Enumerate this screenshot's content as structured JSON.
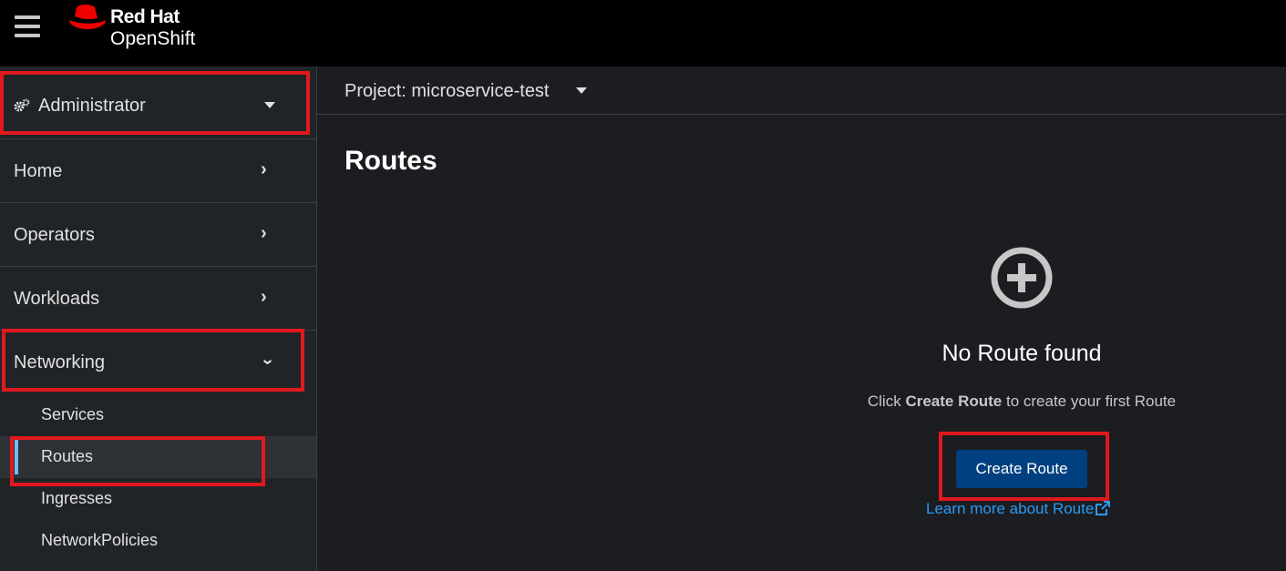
{
  "masthead": {
    "brand_top": "Red Hat",
    "brand_bottom": "OpenShift",
    "menu_icon": "hamburger-icon",
    "logo_icon": "red-hat-fedora-icon"
  },
  "sidebar": {
    "perspective": {
      "label": "Administrator",
      "icon": "cogs-icon"
    },
    "sections": [
      {
        "label": "Home",
        "expanded": false
      },
      {
        "label": "Operators",
        "expanded": false
      },
      {
        "label": "Workloads",
        "expanded": false
      },
      {
        "label": "Networking",
        "expanded": true
      }
    ],
    "networking_items": [
      {
        "label": "Services",
        "active": false
      },
      {
        "label": "Routes",
        "active": true
      },
      {
        "label": "Ingresses",
        "active": false
      },
      {
        "label": "NetworkPolicies",
        "active": false
      }
    ]
  },
  "project_bar": {
    "label": "Project: microservice-test"
  },
  "page": {
    "title": "Routes"
  },
  "empty_state": {
    "icon": "plus-circle-icon",
    "title": "No Route found",
    "body_prefix": "Click ",
    "body_strong": "Create Route",
    "body_suffix": " to create your first Route",
    "button_label": "Create Route",
    "link_label": "Learn more about Route",
    "link_icon": "external-link-icon"
  },
  "colors": {
    "masthead_bg": "#000000",
    "sidebar_bg": "#212427",
    "main_bg": "#1b1d21",
    "primary_button": "#004080",
    "link": "#2b9af3",
    "highlight": "#e0191f",
    "active_indicator": "#73bcf7"
  }
}
